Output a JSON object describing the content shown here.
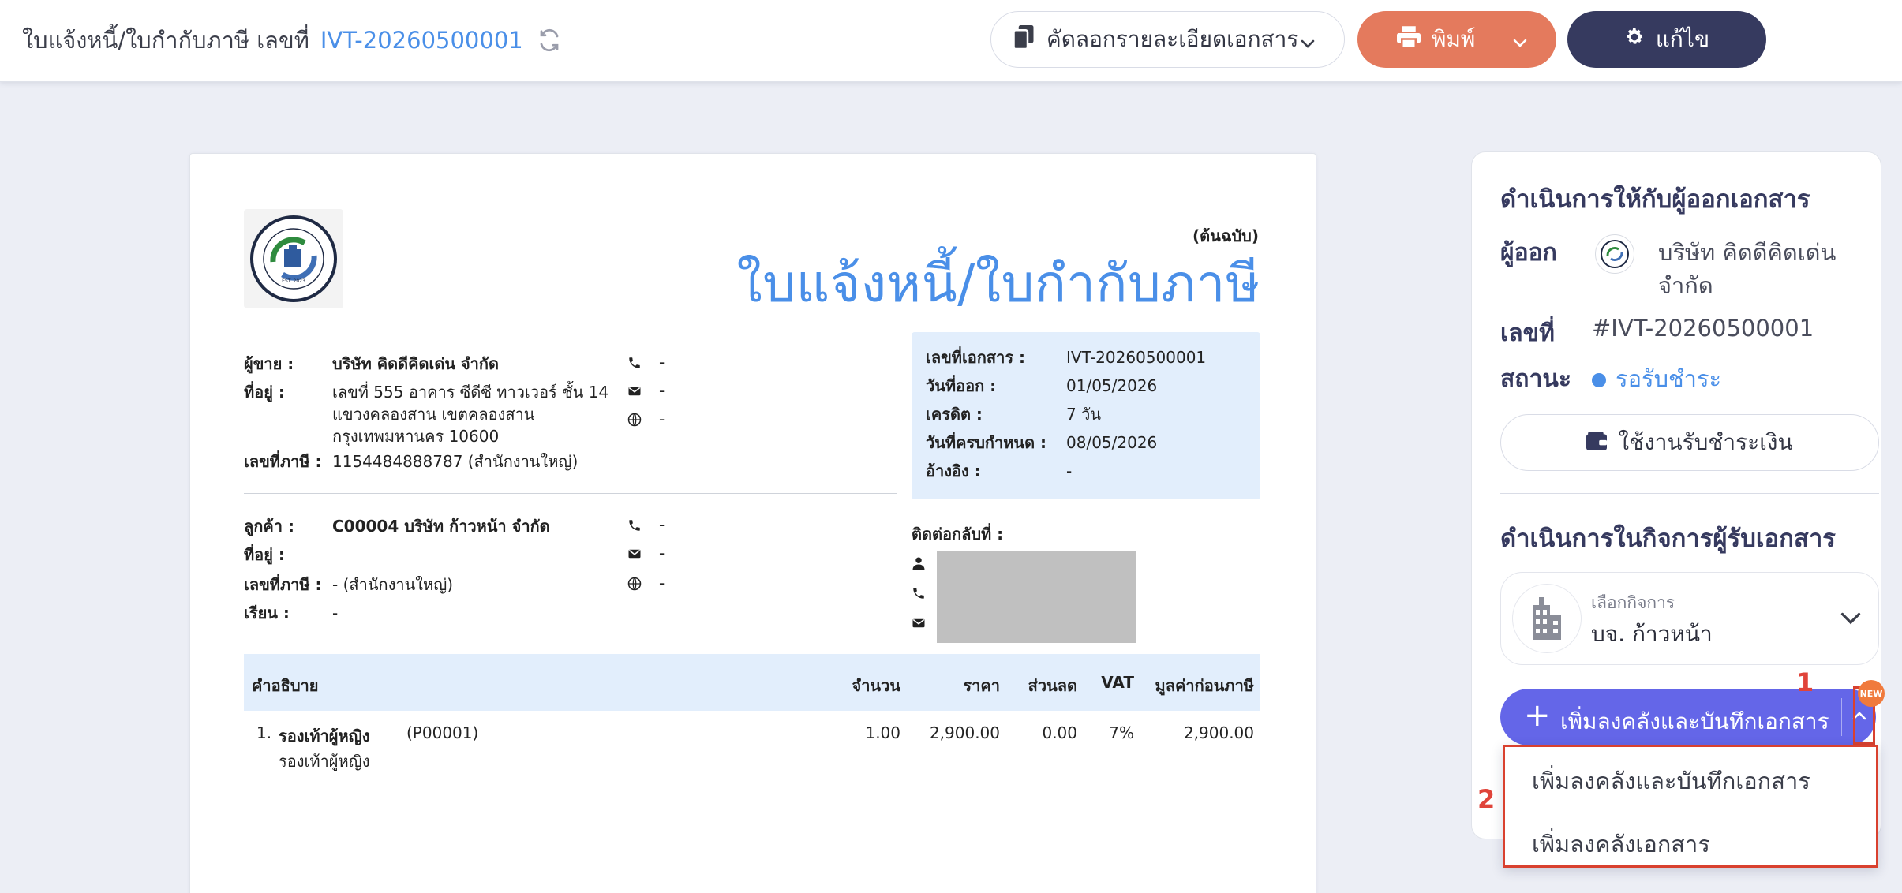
{
  "colors": {
    "link": "#4a8fe8",
    "print_button": "#e47a5d",
    "edit_button": "#363a5f",
    "add_button": "#6466e8",
    "annotation_red": "#d9412f",
    "info_box_bg": "#e2eefc"
  },
  "header": {
    "title_prefix": "ใบแจ้งหนี้/ใบกำกับภาษี เลขที่",
    "doc_number": "IVT-20260500001",
    "refresh_icon": "refresh-icon",
    "copy_button_label": "คัดลอกรายละเอียดเอกสาร",
    "print_button_label": "พิมพ์",
    "edit_button_label": "แก้ไข"
  },
  "document": {
    "copy_tag": "(ต้นฉบับ)",
    "title": "ใบแจ้งหนี้/ใบกำกับภาษี",
    "logo_text": "BUY AND SELL CORPORATION",
    "seller": {
      "seller_label": "ผู้ขาย :",
      "seller_value": "บริษัท คิดดีคิดเด่น จำกัด",
      "address_label": "ที่อยู่ :",
      "address_line1": "เลขที่ 555 อาคาร ซีดีซี ทาวเวอร์ ชั้น 14",
      "address_line2": "แขวงคลองสาน เขตคลองสาน",
      "address_line3": "กรุงเทพมหานคร 10600",
      "tax_label": "เลขที่ภาษี :",
      "tax_value": "1154484888787 (สำนักงานใหญ่)",
      "phone": "-",
      "email": "-",
      "web": "-"
    },
    "customer": {
      "customer_label": "ลูกค้า :",
      "customer_value": "C00004 บริษัท ก้าวหน้า จำกัด",
      "address_label": "ที่อยู่ :",
      "tax_label": "เลขที่ภาษี :",
      "tax_value": "- (สำนักงานใหญ่)",
      "attn_label": "เรียน :",
      "attn_value": "-",
      "phone": "-",
      "email": "-",
      "web": "-"
    },
    "info": {
      "doc_no_label": "เลขที่เอกสาร :",
      "doc_no_value": "IVT-20260500001",
      "issue_date_label": "วันที่ออก :",
      "issue_date_value": "01/05/2026",
      "credit_label": "เครดิต :",
      "credit_value": "7 วัน",
      "due_date_label": "วันที่ครบกำหนด :",
      "due_date_value": "08/05/2026",
      "ref_label": "อ้างอิง :",
      "ref_value": "-"
    },
    "contact_back_label": "ติดต่อกลับที่ :",
    "table": {
      "headers": {
        "desc": "คำอธิบาย",
        "qty": "จำนวน",
        "price": "ราคา",
        "discount": "ส่วนลด",
        "vat": "VAT",
        "amount": "มูลค่าก่อนภาษี"
      },
      "rows": [
        {
          "no": "1.",
          "name": "รองเท้าผู้หญิง",
          "code": "(P00001)",
          "sub": "รองเท้าผู้หญิง",
          "qty": "1.00",
          "price": "2,900.00",
          "discount": "0.00",
          "vat": "7%",
          "amount": "2,900.00"
        }
      ]
    }
  },
  "panel": {
    "issuer_section_title": "ดำเนินการให้กับผู้ออกเอกสาร",
    "issuer_label": "ผู้ออก",
    "issuer_name_line1": "บริษัท คิดดีคิดเด่น",
    "issuer_name_line2": "จำกัด",
    "number_label": "เลขที่",
    "number_value": "#IVT-20260500001",
    "status_label": "สถานะ",
    "status_value": "รอรับชำระ",
    "pay_button_label": "ใช้งานรับชำระเงิน",
    "receiver_section_title": "ดำเนินการในกิจการผู้รับเอกสาร",
    "biz_select_label": "เลือกกิจการ",
    "biz_select_value": "บจ. ก้าวหน้า",
    "add_button_label": "เพิ่มลงคลังและบันทึกเอกสาร",
    "new_badge": "NEW",
    "menu_items": [
      "เพิ่มลงคลังและบันทึกเอกสาร",
      "เพิ่มลงคลังเอกสาร"
    ],
    "annotation_1": "1",
    "annotation_2": "2"
  }
}
